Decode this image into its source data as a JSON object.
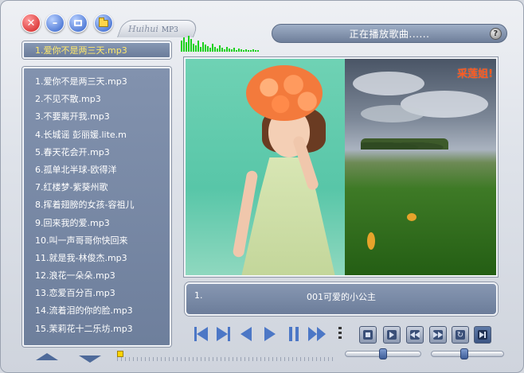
{
  "window": {
    "status_text": "正在播放歌曲......",
    "help_label": "?",
    "logo_text": "Huihui",
    "logo_suffix": "MP3"
  },
  "current_track": "1.爱你不是两三天.mp3",
  "playlist": {
    "items": [
      "1.爱你不是两三天.mp3",
      "2.不见不散.mp3",
      "3.不要离开我.mp3",
      "4.长城谣 彭丽媛.lite.m",
      "5.春天花会开.mp3",
      "6.孤单北半球-欧得洋",
      "7.红楼梦-紫葵州歌",
      "8.挥着翅膀的女孩-容祖儿",
      "9.回来我的爱.mp3",
      "10.叫一声哥哥你快回来",
      "11.就是我-林俊杰.mp3",
      "12.浪花一朵朵.mp3",
      "13.恋爱百分百.mp3",
      "14.流着泪的你的脸.mp3",
      "15.茉莉花十二乐坊.mp3"
    ]
  },
  "video": {
    "caption": "采莲姐!"
  },
  "now_playing": {
    "number": "1.",
    "title": "001可爱的小公主"
  },
  "playback": {
    "progress": 0.0,
    "balance": 0.5,
    "volume": 0.45
  },
  "colors": {
    "accent": "#4c77c6",
    "panel": "#7585a2",
    "current_track_text": "#ffe96b",
    "caption": "#ff5a1e",
    "spectrum": "#1bd11b"
  }
}
